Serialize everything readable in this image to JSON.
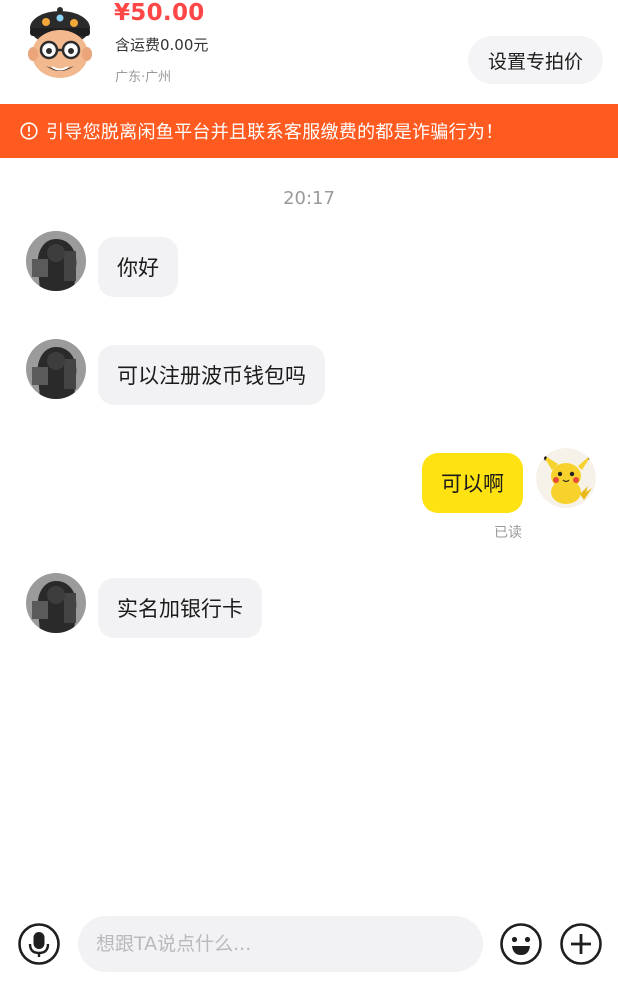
{
  "header": {
    "price": "¥50.00",
    "shipping": "含运费0.00元",
    "location": "广东·广州",
    "set_price_button": "设置专拍价"
  },
  "warning_banner": {
    "text": "引导您脱离闲鱼平台并且联系客服缴费的都是诈骗行为！",
    "background": "#ff5a1f"
  },
  "chat": {
    "timestamp": "20:17",
    "messages": [
      {
        "direction": "incoming",
        "text": "你好"
      },
      {
        "direction": "incoming",
        "text": "可以注册波币钱包吗"
      },
      {
        "direction": "outgoing",
        "text": "可以啊",
        "status": "已读"
      },
      {
        "direction": "incoming",
        "text": "实名加银行卡"
      }
    ]
  },
  "input_bar": {
    "placeholder": "想跟TA说点什么...",
    "value": "",
    "left_icon": "microphone-icon",
    "right_icons": [
      "emoji-icon",
      "plus-icon"
    ]
  },
  "colors": {
    "price": "#ff4747",
    "outgoing_bubble": "#ffe212",
    "incoming_bubble": "#f2f2f4"
  }
}
